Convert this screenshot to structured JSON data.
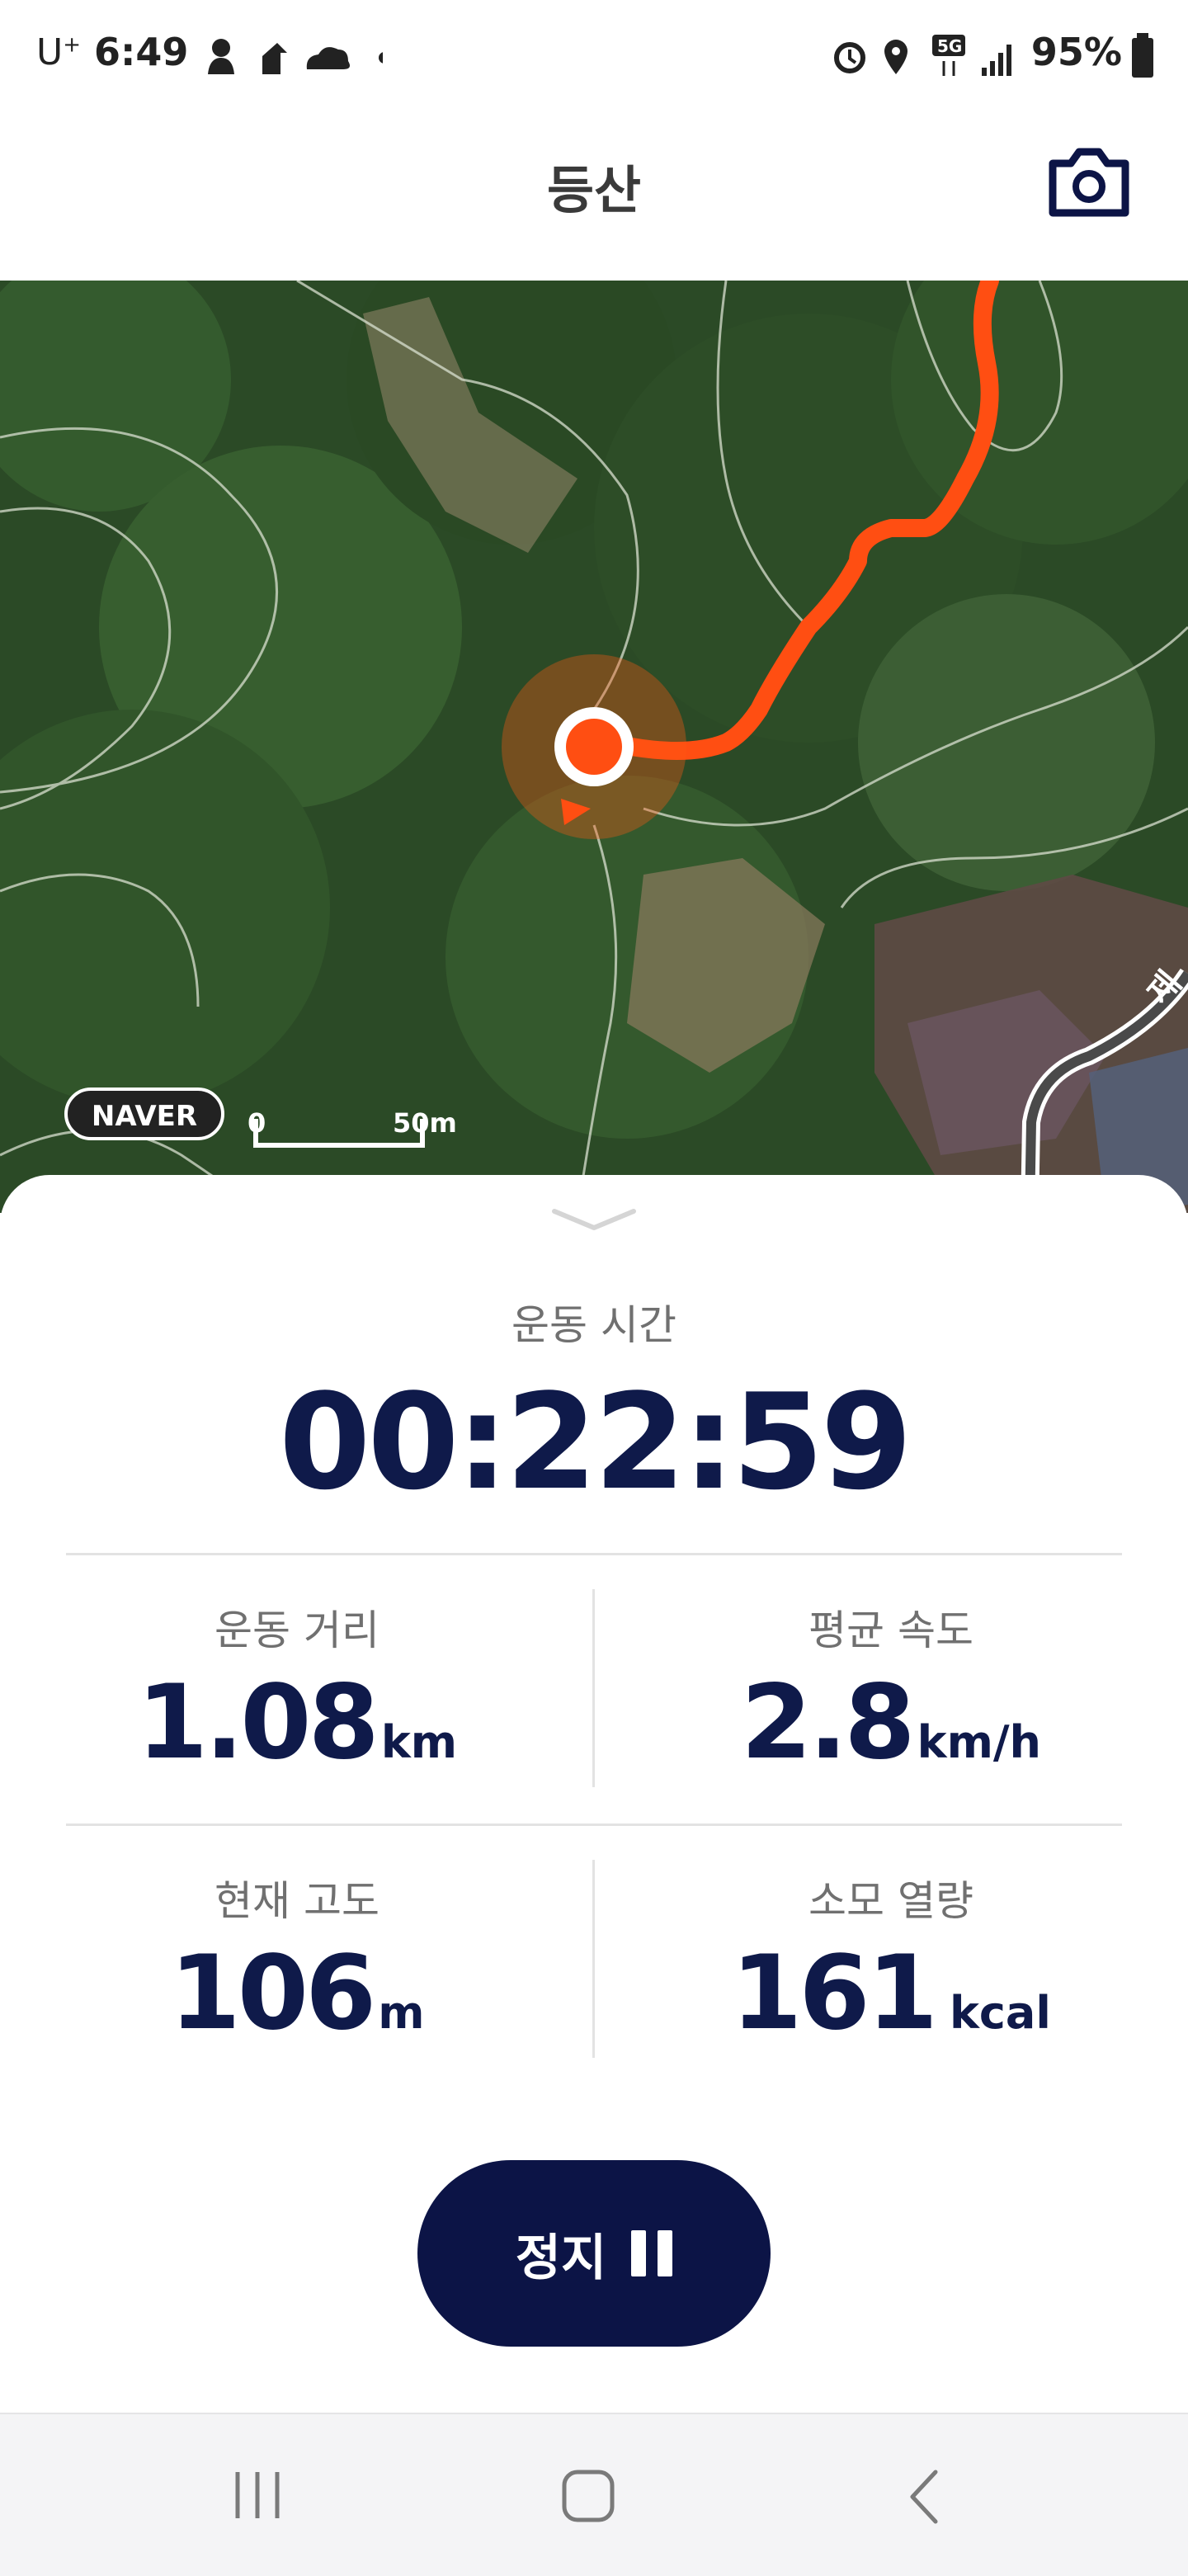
{
  "status_bar": {
    "carrier": "U",
    "carrier_sup": "+",
    "time": "6:49",
    "network": "5G",
    "battery": "95%"
  },
  "header": {
    "title": "등산"
  },
  "map": {
    "provider": "NAVER",
    "scale_start": "0",
    "scale_end": "50m",
    "road_label": "제",
    "track_color": "#ff4e12"
  },
  "stats": {
    "time_label": "운동 시간",
    "time_value": "00:22:59",
    "distance_label": "운동 거리",
    "distance_value": "1.08",
    "distance_unit": "km",
    "speed_label": "평균 속도",
    "speed_value": "2.8",
    "speed_unit": "km/h",
    "altitude_label": "현재 고도",
    "altitude_value": "106",
    "altitude_unit": "m",
    "calories_label": "소모 열량",
    "calories_value": "161",
    "calories_unit": "kcal"
  },
  "controls": {
    "stop_label": "정지"
  },
  "colors": {
    "navy": "#0c1446",
    "accent": "#ff4e12"
  }
}
